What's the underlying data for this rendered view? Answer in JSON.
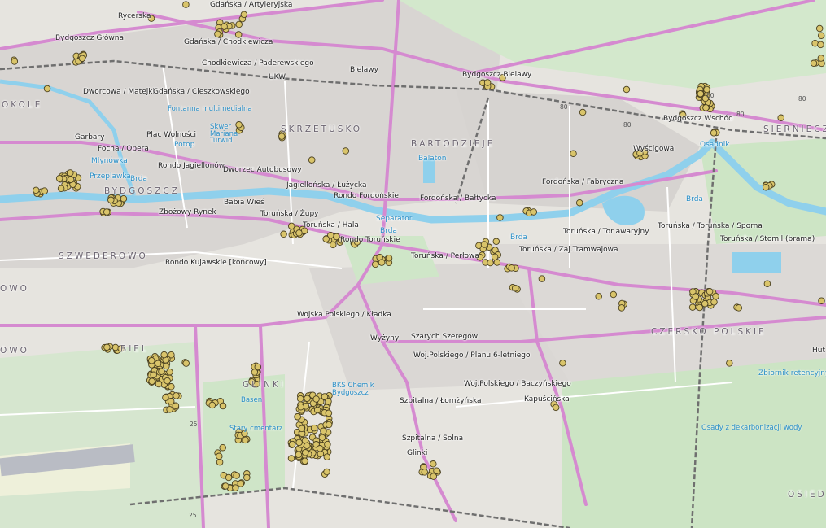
{
  "map": {
    "colors": {
      "land": "#e8e6e2",
      "urban": "#d9d6d3",
      "green": "#cfe7c8",
      "forest": "#b9d9b0",
      "water": "#8fd0ec",
      "road_main": "#d58ad0",
      "road_minor": "#ffffff",
      "rail": "#6f6f6f",
      "marker_fill": "#d9c46a",
      "marker_stroke": "#4a4020"
    },
    "labels": {
      "stops": [
        "Rycerska",
        "Gdańska / Artyleryjska",
        "Bydgoszcz Główna",
        "Gdańska / Chodkiewicza",
        "Chodkiewicza / Paderewskiego",
        "UKW",
        "Bielawy",
        "Bydgoszcz Bielawy",
        "Dworcowa / Matejki",
        "Gdańska / Cieszkowskiego",
        "Garbary",
        "Plac Wolności",
        "Focha / Opera",
        "Rondo Jagiellonów",
        "Dworzec Autobusowy",
        "Jagiellońska / Łużycka",
        "Rondo Fordońskie",
        "Fordońska / Bałtycka",
        "Babia Wieś",
        "Zbożowy Rynek",
        "Toruńska / Żupy",
        "Toruńska / Hala",
        "Rondo Toruńskie",
        "Rondo Kujawskie [końcowy]",
        "Toruńska / Perłowa",
        "Toruńska / Zaj.Tramwajowa",
        "Toruńska / Tor awaryjny",
        "Toruńska / Toruńska / Sporna",
        "Toruńska / Stomil (brama)",
        "Fordońska / Fabryczna",
        "Wojska Polskiego / Kładka",
        "Wyżyny",
        "Szarych Szeregów",
        "Woj.Polskiego / Planu 6-letniego",
        "Woj.Polskiego / Baczyńskiego",
        "Kapuścińska",
        "Szpitalna / Łomżyńska",
        "Szpitalna / Solna",
        "Glinki",
        "Bydgoszcz Wschód",
        "Wyścigowa",
        "Hut"
      ],
      "districts": [
        "OKOLE",
        "BYDGOSZCZ",
        "SZWEDEROWO",
        "OWO",
        "OWO",
        "BIEL",
        "GLINKI",
        "SKRZETUSKO",
        "BARTODZIEJE",
        "CZERSKO POLSKIE",
        "SIERNIECZ",
        "OSIED"
      ],
      "water": [
        "Młynówka",
        "Brda",
        "Brda",
        "Brda",
        "Brda",
        "Balaton",
        "Separator",
        "Osadnik",
        "Potop",
        "Przeplawka",
        "Zbiornik retencyjny"
      ],
      "pois": [
        "Fontanna multimedialna",
        "Skwer Mariana Turwid",
        "BKS Chemik Bydgoszcz",
        "Basen",
        "Stary cmentarz",
        "Osady z dekarbonizacji wody"
      ],
      "roads": [
        "80",
        "80",
        "80",
        "80",
        "80",
        "25",
        "25"
      ]
    }
  }
}
